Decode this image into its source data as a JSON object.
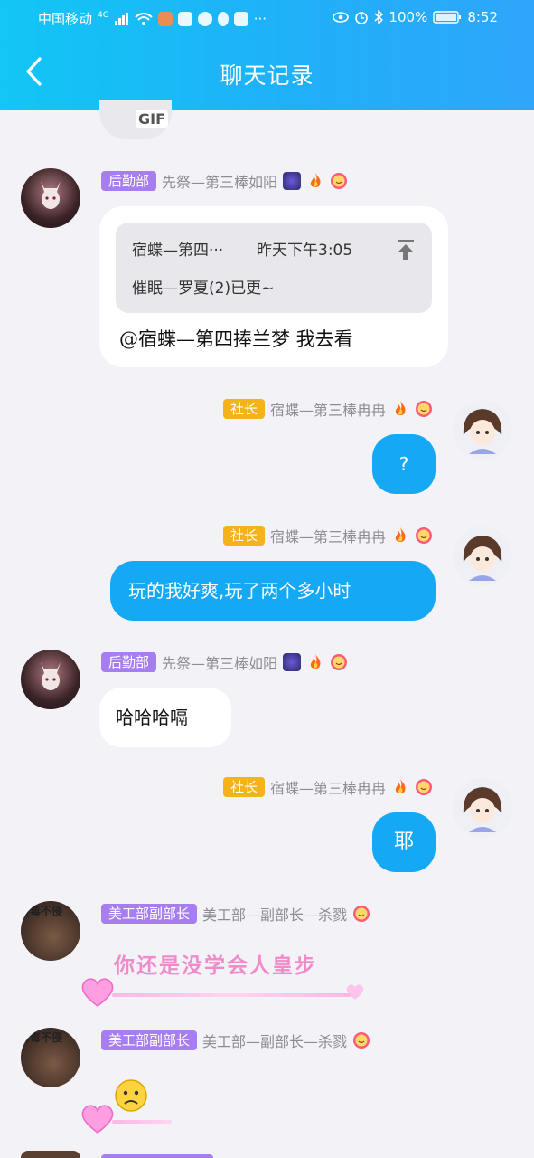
{
  "status_bar": {
    "carrier": "中国移动",
    "signal_label": "4G",
    "battery": "100%",
    "time": "8:52"
  },
  "header": {
    "title": "聊天记录"
  },
  "messages": [
    {
      "tag": "后勤部",
      "nick": "先祭—第三棒如阳",
      "quote_sender": "宿蝶—第四···",
      "quote_time": "昨天下午3:05",
      "quote_text": "催眠—罗夏(2)已更~",
      "text": "@宿蝶—第四捧兰梦 我去看"
    },
    {
      "tag": "社长",
      "nick": "宿蝶—第三棒冉冉",
      "text": "?"
    },
    {
      "tag": "社长",
      "nick": "宿蝶—第三棒冉冉",
      "text": "玩的我好爽,玩了两个多小时"
    },
    {
      "tag": "后勤部",
      "nick": "先祭—第三棒如阳",
      "text": "哈哈哈嗝"
    },
    {
      "tag": "社长",
      "nick": "宿蝶—第三棒冉冉",
      "text": "耶"
    },
    {
      "tag": "美工部副部长",
      "nick": "美工部—副部长—杀戮",
      "text": "你还是没学会人皇步"
    },
    {
      "tag": "美工部副部长",
      "nick": "美工部—副部长—杀戮",
      "text": ""
    }
  ],
  "gif_label": "GIF",
  "avatar_caption": "百毒不侵",
  "colors": {
    "header_start": "#12c6f5",
    "header_end": "#2fa6fb",
    "self_bubble": "#14a8f5",
    "tag_purple": "#a77ef0",
    "tag_gold": "#f4b21b"
  }
}
